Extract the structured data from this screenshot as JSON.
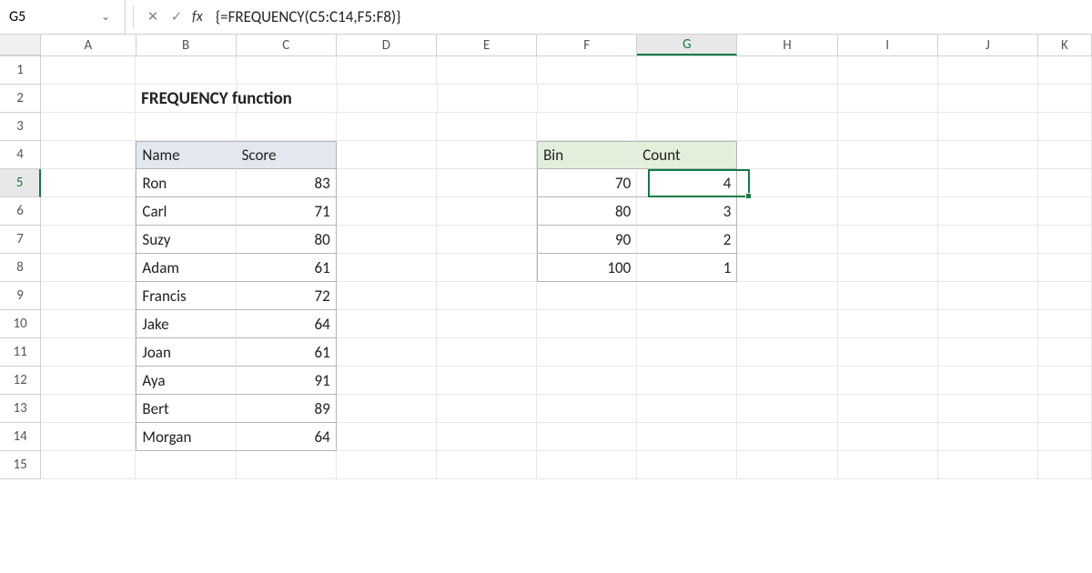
{
  "formula_bar": {
    "cell_ref": "G5",
    "formula": "{=FREQUENCY(C5:C14,F5:F8)}"
  },
  "columns": [
    "A",
    "B",
    "C",
    "D",
    "E",
    "F",
    "G",
    "H",
    "I",
    "J",
    "K"
  ],
  "active_col": "G",
  "rows": [
    "1",
    "2",
    "3",
    "4",
    "5",
    "6",
    "7",
    "8",
    "9",
    "10",
    "11",
    "12",
    "13",
    "14",
    "15"
  ],
  "active_row": "5",
  "title": "FREQUENCY function",
  "table1": {
    "headers": {
      "name": "Name",
      "score": "Score"
    },
    "rows": [
      {
        "name": "Ron",
        "score": "83"
      },
      {
        "name": "Carl",
        "score": "71"
      },
      {
        "name": "Suzy",
        "score": "80"
      },
      {
        "name": "Adam",
        "score": "61"
      },
      {
        "name": "Francis",
        "score": "72"
      },
      {
        "name": "Jake",
        "score": "64"
      },
      {
        "name": "Joan",
        "score": "61"
      },
      {
        "name": "Aya",
        "score": "91"
      },
      {
        "name": "Bert",
        "score": "89"
      },
      {
        "name": "Morgan",
        "score": "64"
      }
    ]
  },
  "table2": {
    "headers": {
      "bin": "Bin",
      "count": "Count"
    },
    "rows": [
      {
        "bin": "70",
        "count": "4"
      },
      {
        "bin": "80",
        "count": "3"
      },
      {
        "bin": "90",
        "count": "2"
      },
      {
        "bin": "100",
        "count": "1"
      }
    ]
  }
}
